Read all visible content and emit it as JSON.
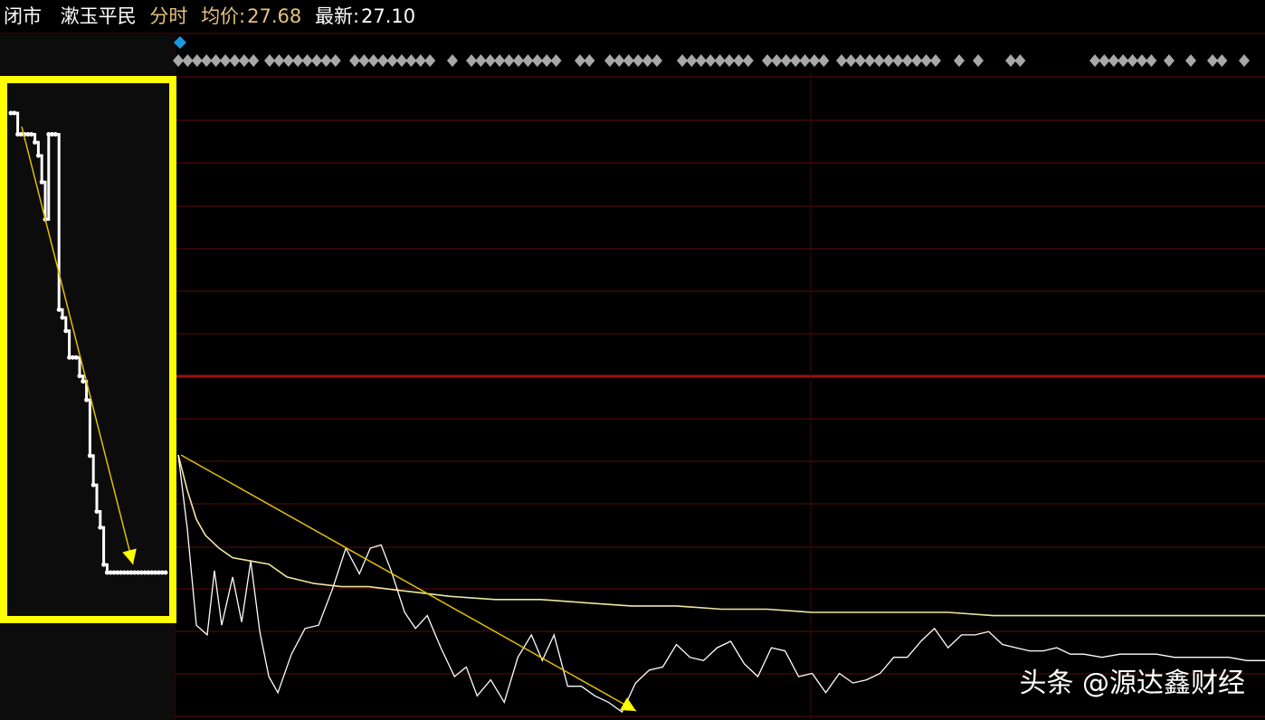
{
  "header": {
    "status": "闭市",
    "stock_name": "漱玉平民",
    "mode": "分时",
    "avg_label": "均价:",
    "avg_value": "27.68",
    "latest_label": "最新:",
    "latest_value": "27.10"
  },
  "watermark": "头条 @源达鑫财经",
  "colors": {
    "background": "#000000",
    "grid": "#5a0d0d",
    "center_line": "#a01010",
    "price_line": "#ffffff",
    "avg_line": "#f0e6a0",
    "highlight_box": "#ffff00",
    "arrow": "#e0c000",
    "diamond": "#a8a8a8",
    "marker": "#1a9ae0"
  },
  "chart_data": [
    {
      "type": "line",
      "panel": "previous-session (highlighted)",
      "series": [
        {
          "x": [
            0,
            4,
            8,
            12,
            16,
            20,
            24,
            28,
            32,
            36,
            40,
            44,
            48,
            52,
            56,
            60,
            64,
            68,
            72,
            76,
            80,
            84,
            88,
            92,
            96,
            100,
            104,
            108,
            112,
            116,
            120,
            124,
            128,
            132,
            136,
            140,
            144,
            148,
            152,
            156,
            160,
            164,
            168,
            172,
            176,
            180
          ],
          "y": [
            99.5,
            99.5,
            98.7,
            98.7,
            98.7,
            98.7,
            98.7,
            98.4,
            97.9,
            96.9,
            95.5,
            98.7,
            98.7,
            98.7,
            92.1,
            91.8,
            91.3,
            90.3,
            90.3,
            90.3,
            89.6,
            89.4,
            88.7,
            86.6,
            85.5,
            84.5,
            83.9,
            82.5,
            82.2,
            82.2,
            82.2,
            82.2,
            82.2,
            82.2,
            82.2,
            82.2,
            82.2,
            82.2,
            82.2,
            82.2,
            82.2,
            82.2,
            82.2,
            82.2,
            82.2,
            82.2
          ]
        }
      ]
    },
    {
      "type": "line",
      "panel": "intraday",
      "series": [
        {
          "x": [
            0,
            10,
            20,
            32,
            40,
            48,
            60,
            70,
            80,
            90,
            100,
            110,
            125,
            140,
            155,
            170,
            185,
            200,
            212,
            224,
            235,
            250,
            262,
            275,
            290,
            305,
            318,
            330,
            345,
            360,
            375,
            390,
            402,
            415,
            430,
            445,
            460,
            475,
            490,
            505,
            520,
            535,
            550,
            565,
            580,
            595,
            610,
            625,
            640,
            655,
            670,
            685,
            700,
            715,
            730,
            745,
            760,
            775,
            790,
            805,
            820,
            835,
            850,
            865,
            880,
            895,
            910,
            925,
            940,
            955,
            970,
            985,
            1000,
            1020,
            1040,
            1060,
            1080,
            1100,
            1120,
            1140,
            1160,
            1180,
            1200
          ],
          "y": [
            97.8,
            95.5,
            92.5,
            92.2,
            94.2,
            92.5,
            94.0,
            92.6,
            94.5,
            92.3,
            90.9,
            90.4,
            91.6,
            92.4,
            92.5,
            93.6,
            94.9,
            94.1,
            94.9,
            95.0,
            94.2,
            92.9,
            92.4,
            92.8,
            91.8,
            90.9,
            91.2,
            90.3,
            90.8,
            90.1,
            91.5,
            92.2,
            91.4,
            92.2,
            90.6,
            90.6,
            90.3,
            90.1,
            89.8,
            90.7,
            91.1,
            91.2,
            91.9,
            91.5,
            91.4,
            91.8,
            92.0,
            91.3,
            90.9,
            91.8,
            91.7,
            90.9,
            91.0,
            90.4,
            91.0,
            90.7,
            90.8,
            91.0,
            91.5,
            91.5,
            92.0,
            92.4,
            91.8,
            92.2,
            92.2,
            92.3,
            91.9,
            91.8,
            91.7,
            91.7,
            91.8,
            91.6,
            91.6,
            91.5,
            91.6,
            91.6,
            91.6,
            91.5,
            91.5,
            91.5,
            91.5,
            91.4,
            91.4
          ]
        },
        {
          "x": [
            0,
            10,
            20,
            30,
            45,
            60,
            80,
            100,
            120,
            150,
            180,
            210,
            240,
            270,
            300,
            350,
            400,
            450,
            500,
            550,
            600,
            650,
            700,
            750,
            800,
            850,
            900,
            950,
            1000,
            1050,
            1100,
            1150,
            1200
          ],
          "y": [
            97.8,
            96.7,
            95.8,
            95.3,
            94.9,
            94.6,
            94.5,
            94.4,
            94.0,
            93.8,
            93.7,
            93.7,
            93.6,
            93.5,
            93.4,
            93.3,
            93.3,
            93.2,
            93.1,
            93.1,
            93.0,
            93.0,
            92.9,
            92.9,
            92.9,
            92.9,
            92.8,
            92.8,
            92.8,
            92.8,
            92.8,
            92.8,
            92.8
          ]
        }
      ]
    }
  ]
}
